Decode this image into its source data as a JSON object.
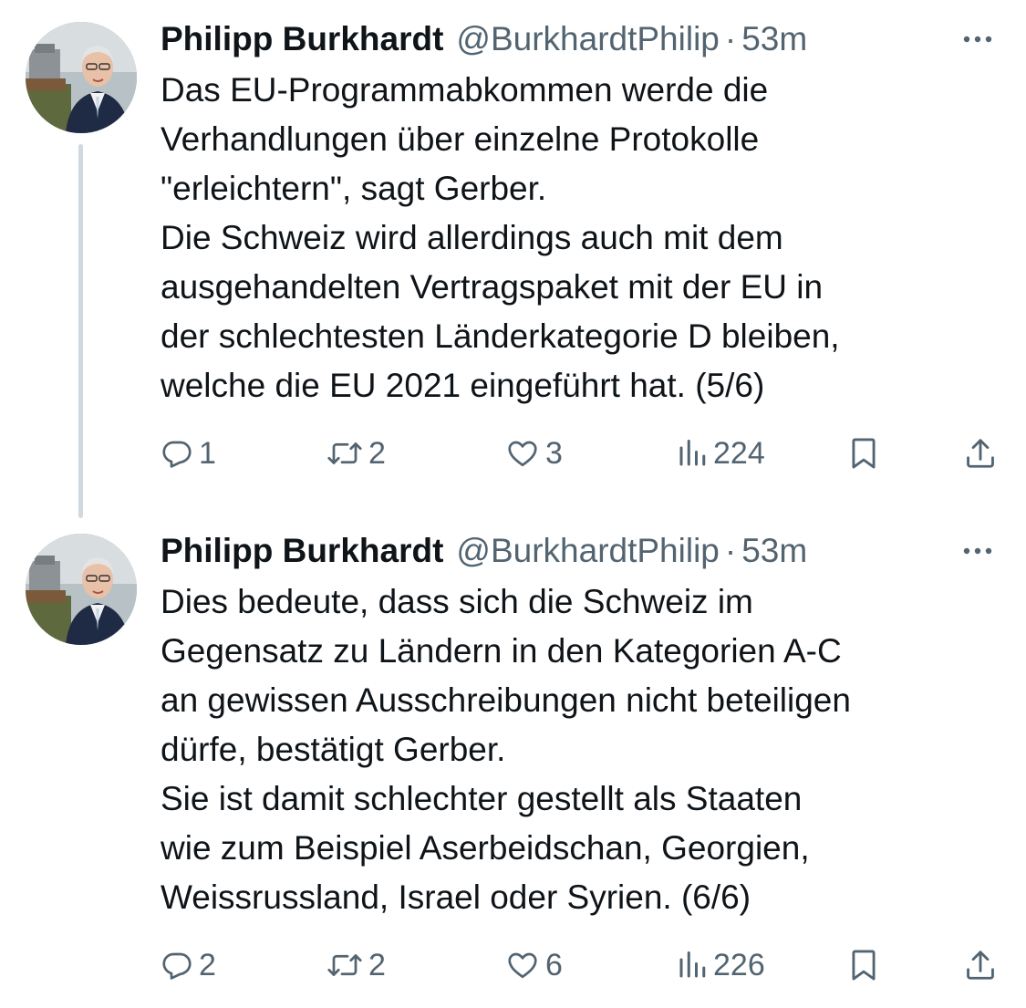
{
  "tweets": [
    {
      "author": {
        "name": "Philipp Burkhardt",
        "handle": "@BurkhardtPhilip",
        "separator": "·",
        "time": "53m",
        "avatar_icon": "avatar-photo"
      },
      "lines": [
        "Das EU-Programmabkommen werde die",
        "Verhandlungen über einzelne Protokolle",
        "\"erleichtern\", sagt Gerber.",
        "Die Schweiz wird allerdings auch mit dem",
        "ausgehandelten Vertragspaket mit der EU in",
        "der schlechtesten Länderkategorie D bleiben,",
        "welche die EU 2021 eingeführt hat. (5/6)"
      ],
      "metrics": {
        "replies": "1",
        "reposts": "2",
        "likes": "3",
        "views": "224"
      }
    },
    {
      "author": {
        "name": "Philipp Burkhardt",
        "handle": "@BurkhardtPhilip",
        "separator": "·",
        "time": "53m",
        "avatar_icon": "avatar-photo"
      },
      "lines": [
        "Dies bedeute, dass sich die Schweiz im",
        "Gegensatz zu Ländern in den Kategorien A-C",
        "an gewissen Ausschreibungen nicht beteiligen",
        "dürfe, bestätigt Gerber.",
        "Sie ist damit schlechter gestellt als Staaten",
        "wie zum Beispiel Aserbeidschan, Georgien,",
        "Weissrussland, Israel oder Syrien. (6/6)"
      ],
      "metrics": {
        "replies": "2",
        "reposts": "2",
        "likes": "6",
        "views": "226"
      }
    }
  ],
  "icons": {
    "more": "more-horizontal-icon",
    "reply": "reply-icon",
    "repost": "repost-icon",
    "like": "heart-icon",
    "views": "views-chart-icon",
    "bookmark": "bookmark-icon",
    "share": "share-icon"
  },
  "colors": {
    "text_primary": "#0f1419",
    "text_secondary": "#536471",
    "thread_line": "#cfd9de",
    "background": "#ffffff"
  }
}
